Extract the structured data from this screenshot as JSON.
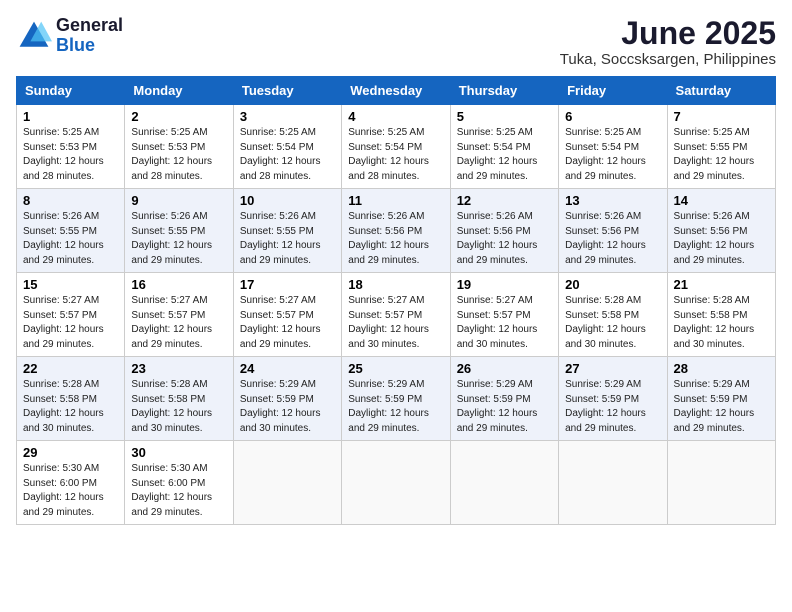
{
  "header": {
    "logo_general": "General",
    "logo_blue": "Blue",
    "title": "June 2025",
    "subtitle": "Tuka, Soccsksargen, Philippines"
  },
  "calendar": {
    "columns": [
      "Sunday",
      "Monday",
      "Tuesday",
      "Wednesday",
      "Thursday",
      "Friday",
      "Saturday"
    ],
    "weeks": [
      [
        null,
        {
          "day": "2",
          "sunrise": "5:25 AM",
          "sunset": "5:53 PM",
          "daylight": "12 hours and 28 minutes."
        },
        {
          "day": "3",
          "sunrise": "5:25 AM",
          "sunset": "5:54 PM",
          "daylight": "12 hours and 28 minutes."
        },
        {
          "day": "4",
          "sunrise": "5:25 AM",
          "sunset": "5:54 PM",
          "daylight": "12 hours and 28 minutes."
        },
        {
          "day": "5",
          "sunrise": "5:25 AM",
          "sunset": "5:54 PM",
          "daylight": "12 hours and 29 minutes."
        },
        {
          "day": "6",
          "sunrise": "5:25 AM",
          "sunset": "5:54 PM",
          "daylight": "12 hours and 29 minutes."
        },
        {
          "day": "7",
          "sunrise": "5:25 AM",
          "sunset": "5:55 PM",
          "daylight": "12 hours and 29 minutes."
        }
      ],
      [
        {
          "day": "1",
          "sunrise": "5:25 AM",
          "sunset": "5:53 PM",
          "daylight": "12 hours and 28 minutes."
        },
        {
          "day": "9",
          "sunrise": "5:26 AM",
          "sunset": "5:55 PM",
          "daylight": "12 hours and 29 minutes."
        },
        {
          "day": "10",
          "sunrise": "5:26 AM",
          "sunset": "5:55 PM",
          "daylight": "12 hours and 29 minutes."
        },
        {
          "day": "11",
          "sunrise": "5:26 AM",
          "sunset": "5:56 PM",
          "daylight": "12 hours and 29 minutes."
        },
        {
          "day": "12",
          "sunrise": "5:26 AM",
          "sunset": "5:56 PM",
          "daylight": "12 hours and 29 minutes."
        },
        {
          "day": "13",
          "sunrise": "5:26 AM",
          "sunset": "5:56 PM",
          "daylight": "12 hours and 29 minutes."
        },
        {
          "day": "14",
          "sunrise": "5:26 AM",
          "sunset": "5:56 PM",
          "daylight": "12 hours and 29 minutes."
        }
      ],
      [
        {
          "day": "8",
          "sunrise": "5:26 AM",
          "sunset": "5:55 PM",
          "daylight": "12 hours and 29 minutes."
        },
        {
          "day": "16",
          "sunrise": "5:27 AM",
          "sunset": "5:57 PM",
          "daylight": "12 hours and 29 minutes."
        },
        {
          "day": "17",
          "sunrise": "5:27 AM",
          "sunset": "5:57 PM",
          "daylight": "12 hours and 29 minutes."
        },
        {
          "day": "18",
          "sunrise": "5:27 AM",
          "sunset": "5:57 PM",
          "daylight": "12 hours and 30 minutes."
        },
        {
          "day": "19",
          "sunrise": "5:27 AM",
          "sunset": "5:57 PM",
          "daylight": "12 hours and 30 minutes."
        },
        {
          "day": "20",
          "sunrise": "5:28 AM",
          "sunset": "5:58 PM",
          "daylight": "12 hours and 30 minutes."
        },
        {
          "day": "21",
          "sunrise": "5:28 AM",
          "sunset": "5:58 PM",
          "daylight": "12 hours and 30 minutes."
        }
      ],
      [
        {
          "day": "15",
          "sunrise": "5:27 AM",
          "sunset": "5:57 PM",
          "daylight": "12 hours and 29 minutes."
        },
        {
          "day": "23",
          "sunrise": "5:28 AM",
          "sunset": "5:58 PM",
          "daylight": "12 hours and 30 minutes."
        },
        {
          "day": "24",
          "sunrise": "5:29 AM",
          "sunset": "5:59 PM",
          "daylight": "12 hours and 30 minutes."
        },
        {
          "day": "25",
          "sunrise": "5:29 AM",
          "sunset": "5:59 PM",
          "daylight": "12 hours and 29 minutes."
        },
        {
          "day": "26",
          "sunrise": "5:29 AM",
          "sunset": "5:59 PM",
          "daylight": "12 hours and 29 minutes."
        },
        {
          "day": "27",
          "sunrise": "5:29 AM",
          "sunset": "5:59 PM",
          "daylight": "12 hours and 29 minutes."
        },
        {
          "day": "28",
          "sunrise": "5:29 AM",
          "sunset": "5:59 PM",
          "daylight": "12 hours and 29 minutes."
        }
      ],
      [
        {
          "day": "22",
          "sunrise": "5:28 AM",
          "sunset": "5:58 PM",
          "daylight": "12 hours and 30 minutes."
        },
        {
          "day": "30",
          "sunrise": "5:30 AM",
          "sunset": "6:00 PM",
          "daylight": "12 hours and 29 minutes."
        },
        null,
        null,
        null,
        null,
        null
      ],
      [
        {
          "day": "29",
          "sunrise": "5:30 AM",
          "sunset": "6:00 PM",
          "daylight": "12 hours and 29 minutes."
        },
        null,
        null,
        null,
        null,
        null,
        null
      ]
    ]
  }
}
